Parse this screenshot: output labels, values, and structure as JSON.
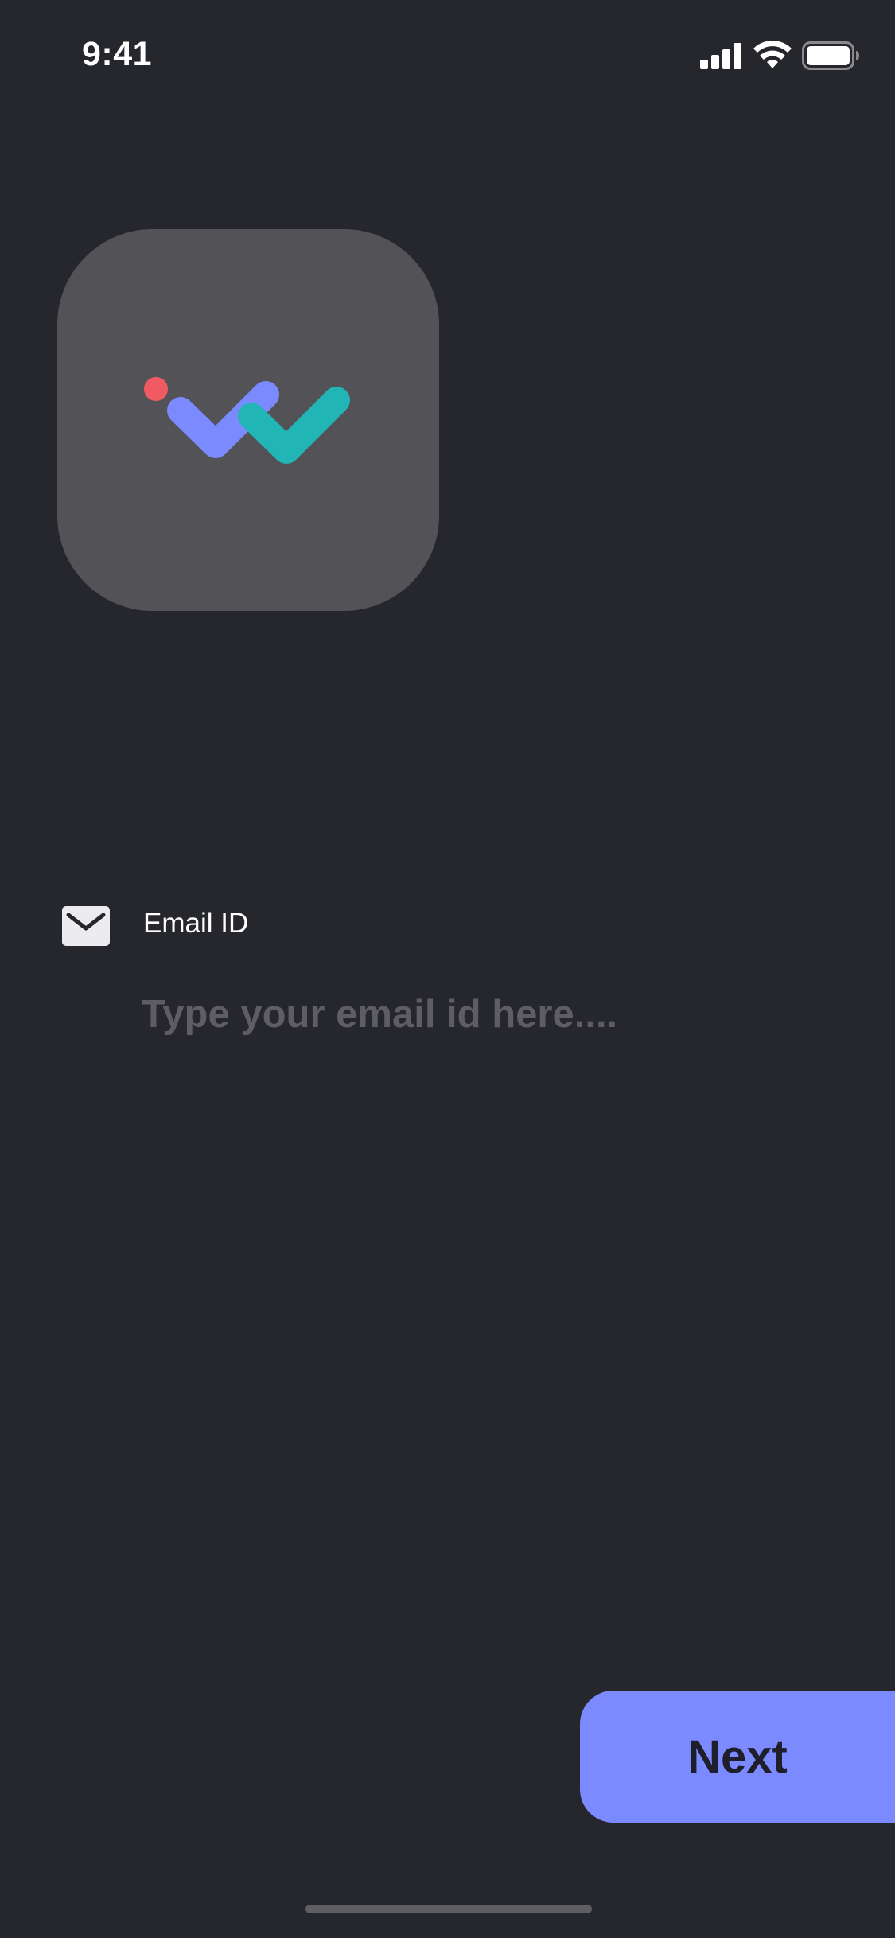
{
  "status_bar": {
    "time": "9:41",
    "icons": [
      "cellular-signal-icon",
      "wifi-icon",
      "battery-icon"
    ]
  },
  "logo": {
    "icon": "app-logo-icon",
    "colors": {
      "tile": "#535257",
      "dot": "#f25a63",
      "left_check": "#7b8bff",
      "right_check": "#22b5b5"
    }
  },
  "email": {
    "icon": "mail-icon",
    "label": "Email ID",
    "value": "",
    "placeholder": "Type your email id here...."
  },
  "next_button": {
    "label": "Next",
    "color": "#7b8bff"
  },
  "theme": {
    "background": "#26272c",
    "placeholder_color": "#5d5d63"
  }
}
